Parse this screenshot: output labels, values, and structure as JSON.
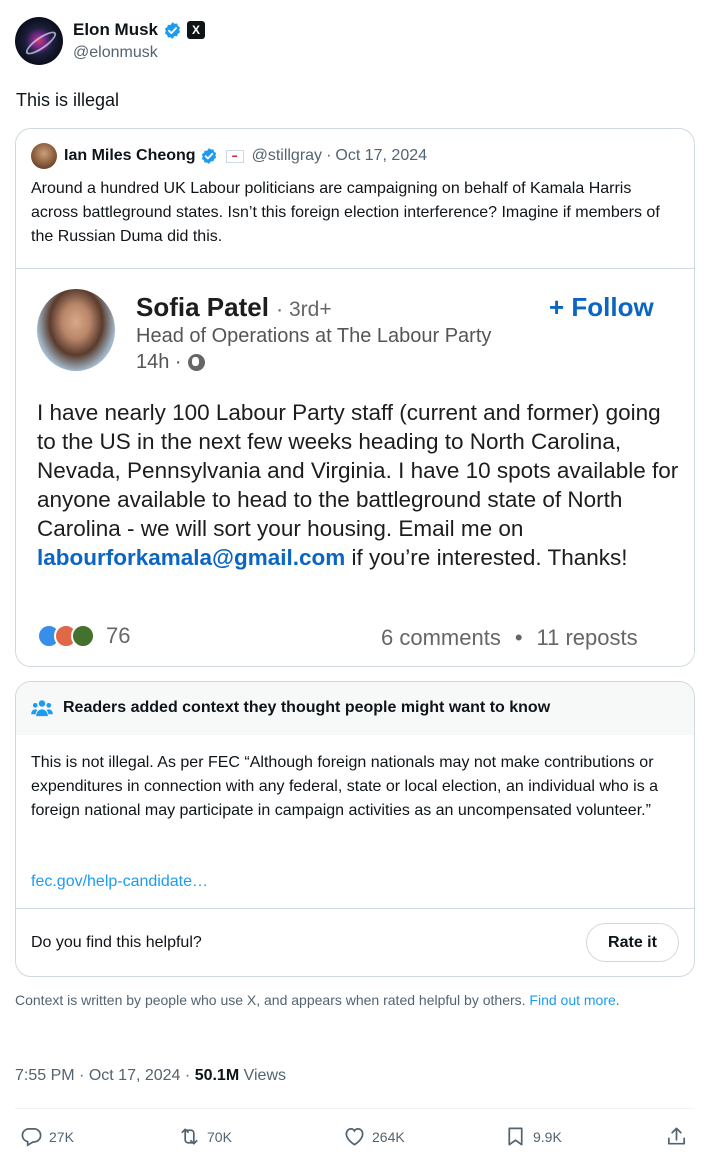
{
  "author": {
    "name": "Elon Musk",
    "handle": "@elonmusk",
    "x_badge": "X",
    "avatar_icon": "black-hole-avatar"
  },
  "tweet": {
    "text": "This is illegal"
  },
  "quoted": {
    "name": "Ian Miles Cheong",
    "handle": "@stillgray",
    "separator": "·",
    "date": "Oct 17, 2024",
    "text": "Around a hundred UK Labour politicians are campaigning on behalf of Kamala Harris across battleground states. Isn’t this foreign election interference? Imagine if members of the Russian Duma did this.",
    "image": {
      "name": "Sofia Patel",
      "degree": "· 3rd+",
      "follow_label": "+ Follow",
      "title": "Head of Operations at The Labour Party",
      "time": "14h ·",
      "body_before": "I have nearly 100 Labour Party staff (current and former) going to the US in the next few weeks heading to North Carolina, Nevada, Pennsylvania and Virginia. I have 10 spots available for anyone available to head to the battleground state of North Carolina - we will sort your housing. Email me on ",
      "email": "labourforkamala@gmail.com",
      "body_after": " if you’re interested. Thanks!",
      "reactions_count": "76",
      "comments": "6 comments",
      "dot": "•",
      "reposts": "11 reposts"
    }
  },
  "note": {
    "title": "Readers added context they thought people might want to know",
    "body": "This is not illegal. As per FEC “Although foreign nationals may not make contributions or expenditures in connection with any federal, state or local election, an individual who is a foreign national may participate in campaign activities as an uncompensated volunteer.”",
    "link": "fec.gov/help-candidate…",
    "question": "Do you find this helpful?",
    "rate_label": "Rate it",
    "footer_text": "Context is written by people who use X, and appears when rated helpful by others.",
    "footer_link": "Find out more",
    "footer_period": "."
  },
  "meta": {
    "time": "7:55 PM",
    "sep": "·",
    "date": "Oct 17, 2024",
    "views_num": "50.1M",
    "views_label": "Views"
  },
  "actions": {
    "replies": "27K",
    "reposts": "70K",
    "likes": "264K",
    "bookmarks": "9.9K"
  },
  "colors": {
    "accent": "#1d9bf0",
    "linkedin_blue": "#0a66c2",
    "muted": "#536471",
    "border": "#cfd9de"
  }
}
